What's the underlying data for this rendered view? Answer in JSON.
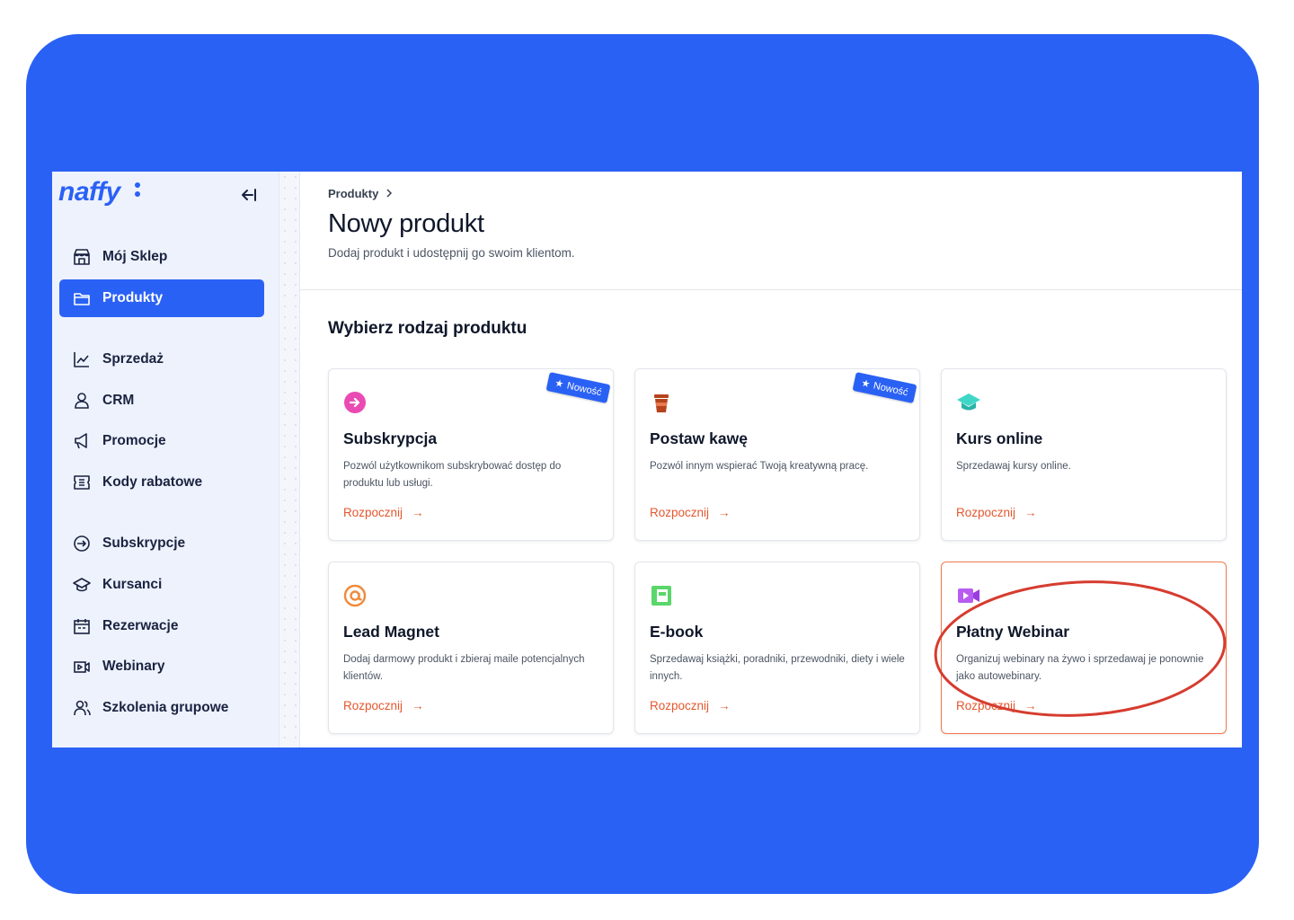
{
  "brand": {
    "logo_text": "naffy",
    "accent": "#2a61f5",
    "link_color": "#e4572e",
    "highlight_color": "#f07a4f"
  },
  "sidebar": {
    "collapse_icon": "collapse-left-icon",
    "items": [
      {
        "label": "Mój Sklep",
        "icon": "store-icon"
      },
      {
        "label": "Produkty",
        "icon": "folder-icon",
        "active": true
      },
      {
        "label": "Sprzedaż",
        "icon": "chart-line-icon"
      },
      {
        "label": "CRM",
        "icon": "user-icon"
      },
      {
        "label": "Promocje",
        "icon": "megaphone-icon"
      },
      {
        "label": "Kody rabatowe",
        "icon": "ticket-icon"
      },
      {
        "label": "Subskrypcje",
        "icon": "subscription-icon"
      },
      {
        "label": "Kursanci",
        "icon": "graduation-cap-icon"
      },
      {
        "label": "Rezerwacje",
        "icon": "calendar-icon"
      },
      {
        "label": "Webinary",
        "icon": "video-icon"
      },
      {
        "label": "Szkolenia grupowe",
        "icon": "users-icon"
      }
    ]
  },
  "header": {
    "breadcrumb": "Produkty",
    "title": "Nowy produkt",
    "subtitle": "Dodaj produkt i udostępnij go swoim klientom."
  },
  "section_title": "Wybierz rodzaj produktu",
  "cards": [
    {
      "title": "Subskrypcja",
      "desc": "Pozwól użytkownikom subskrybować dostęp do produktu lub usługi.",
      "link": "Rozpocznij",
      "badge": "Nowość",
      "icon": "subscription-arrow-icon",
      "icon_color": "#e94bb3"
    },
    {
      "title": "Postaw kawę",
      "desc": "Pozwól innym wspierać Twoją kreatywną pracę.",
      "link": "Rozpocznij",
      "badge": "Nowość",
      "icon": "coffee-cup-icon",
      "icon_color": "#b5431c"
    },
    {
      "title": "Kurs online",
      "desc": "Sprzedawaj kursy online.",
      "link": "Rozpocznij",
      "icon": "graduation-cap-icon",
      "icon_color": "#3fd6c8"
    },
    {
      "title": "Lead Magnet",
      "desc": "Dodaj darmowy produkt i zbieraj maile potencjalnych klientów.",
      "link": "Rozpocznij",
      "icon": "at-sign-icon",
      "icon_color": "#f08a3c"
    },
    {
      "title": "E-book",
      "desc": "Sprzedawaj książki, poradniki, przewodniki, diety i wiele innych.",
      "link": "Rozpocznij",
      "icon": "book-icon",
      "icon_color": "#5ad66a"
    },
    {
      "title": "Płatny Webinar",
      "desc": "Organizuj webinary na żywo i sprzedawaj je ponownie jako autowebinary.",
      "link": "Rozpocznij",
      "icon": "video-camera-icon",
      "icon_color": "#b85cf0",
      "highlighted": true
    }
  ]
}
